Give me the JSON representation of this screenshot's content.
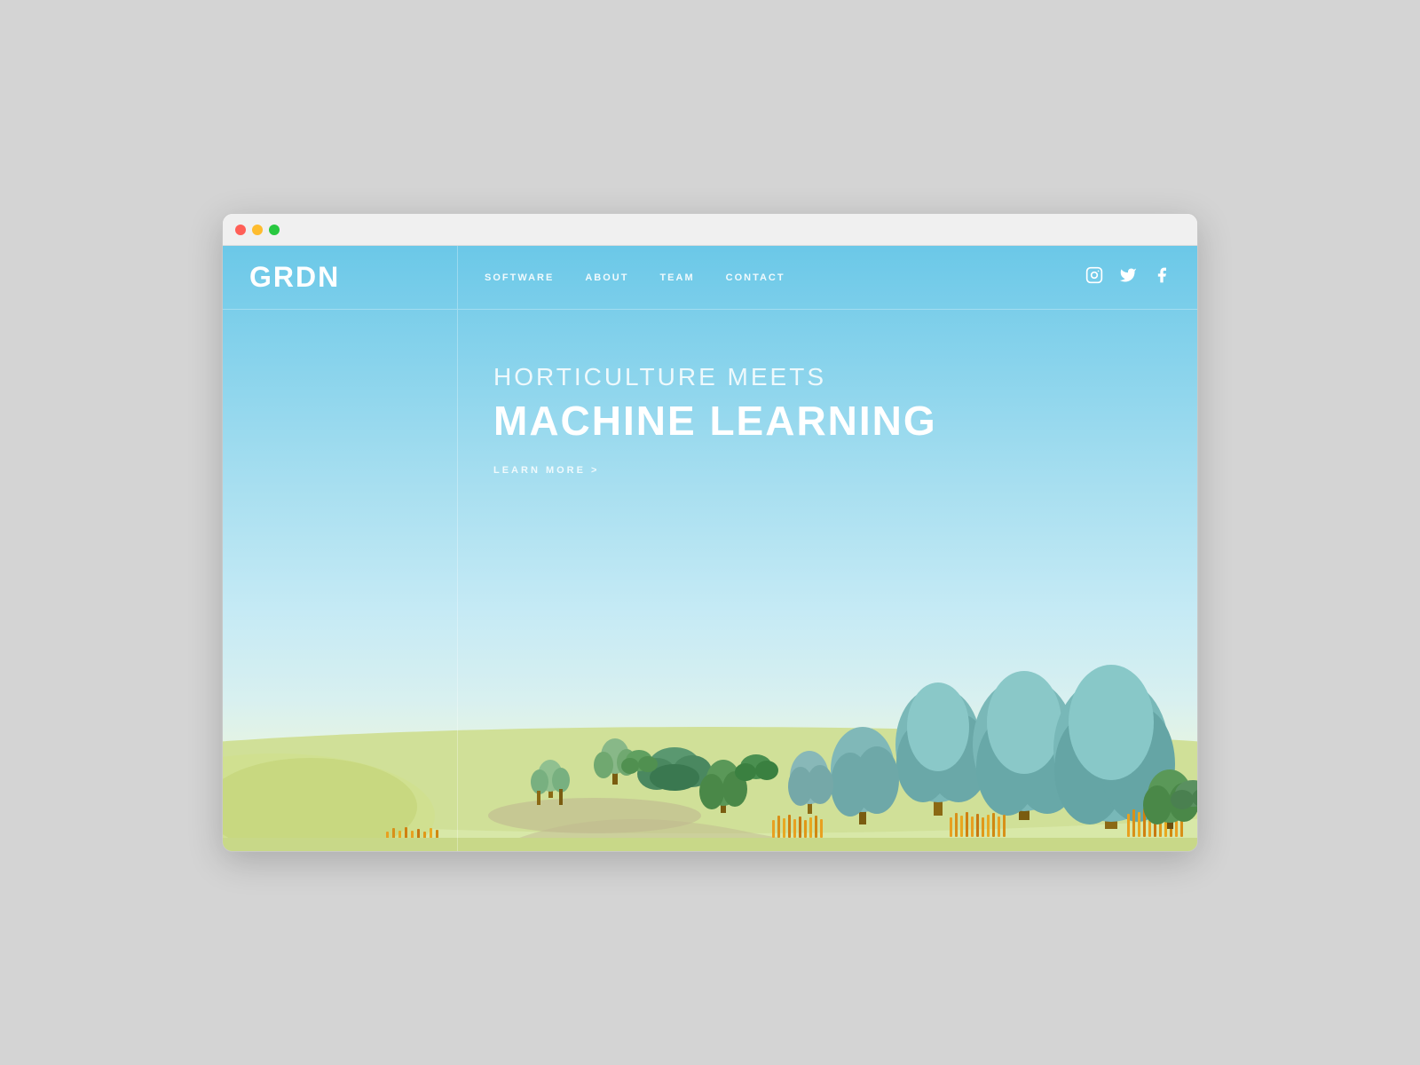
{
  "browser": {
    "traffic_lights": [
      "red",
      "yellow",
      "green"
    ]
  },
  "header": {
    "logo": "GRDN",
    "nav": {
      "items": [
        {
          "label": "SOFTWARE",
          "href": "#"
        },
        {
          "label": "ABOUT",
          "href": "#"
        },
        {
          "label": "TEAM",
          "href": "#"
        },
        {
          "label": "CONTACT",
          "href": "#"
        }
      ]
    },
    "social": {
      "instagram": "Instagram",
      "twitter": "Twitter",
      "facebook": "Facebook"
    }
  },
  "hero": {
    "subtitle": "HORTICULTURE MEETS",
    "title": "MACHINE LEARNING",
    "cta": "LEARN MORE >"
  },
  "colors": {
    "sky_top": "#5bbde0",
    "sky_bottom": "#a8dff0",
    "accent_white": "#ffffff",
    "nav_text": "rgba(255,255,255,0.85)"
  }
}
